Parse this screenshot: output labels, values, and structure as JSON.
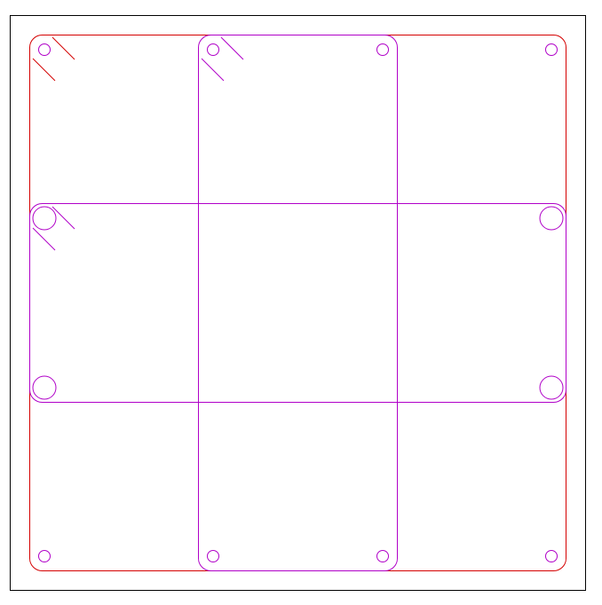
{
  "drawing": {
    "background": "#ffffff",
    "frame_color": "#000000",
    "outer_panel_color": "#d40000",
    "module_color": "#b000c8"
  }
}
